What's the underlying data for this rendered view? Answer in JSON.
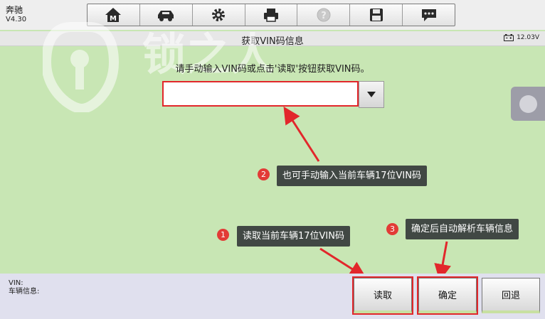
{
  "brand": {
    "name": "奔驰",
    "version": "V4.30"
  },
  "toolbar": {
    "items": [
      {
        "icon": "home-icon"
      },
      {
        "icon": "car-repair-icon"
      },
      {
        "icon": "settings-gear-icon"
      },
      {
        "icon": "printer-icon"
      },
      {
        "icon": "help-icon"
      },
      {
        "icon": "save-icon"
      },
      {
        "icon": "message-icon"
      }
    ]
  },
  "titlebar": {
    "title": "获取VIN码信息",
    "battery": "12.03V"
  },
  "watermark": {
    "text": "锁之人"
  },
  "main": {
    "instruction": "请手动输入VIN码或点击'读取'按钮获取VIN码。",
    "vin_value": ""
  },
  "annotations": {
    "a1": {
      "num": "1",
      "text": "读取当前车辆17位VIN码"
    },
    "a2": {
      "num": "2",
      "text": "也可手动输入当前车辆17位VIN码"
    },
    "a3": {
      "num": "3",
      "text": "确定后自动解析车辆信息"
    }
  },
  "bottom": {
    "vin_label": "VIN:",
    "vehicle_info_label": "车辆信息:",
    "buttons": {
      "read": "读取",
      "confirm": "确定",
      "back": "回退"
    }
  },
  "colors": {
    "accent_red": "#e2272b",
    "background": "#c8e6b4"
  }
}
